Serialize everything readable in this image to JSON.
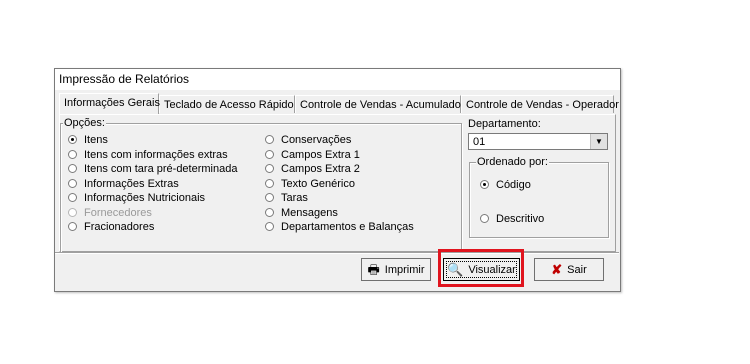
{
  "window": {
    "title": "Impressão de Relatórios"
  },
  "tabs": [
    {
      "label": "Informações Gerais",
      "active": true
    },
    {
      "label": "Teclado de Acesso Rápido",
      "active": false
    },
    {
      "label": "Controle de Vendas - Acumulados",
      "active": false
    },
    {
      "label": "Controle de Vendas - Operador",
      "active": false
    }
  ],
  "opcoes": {
    "legend": "Opções:",
    "col1": [
      {
        "label": "Itens",
        "selected": true,
        "disabled": false
      },
      {
        "label": "Itens com informações extras",
        "selected": false,
        "disabled": false
      },
      {
        "label": "Itens com tara pré-determinada",
        "selected": false,
        "disabled": false
      },
      {
        "label": "Informações Extras",
        "selected": false,
        "disabled": false
      },
      {
        "label": "Informações Nutricionais",
        "selected": false,
        "disabled": false
      },
      {
        "label": "Fornecedores",
        "selected": false,
        "disabled": true
      },
      {
        "label": "Fracionadores",
        "selected": false,
        "disabled": false
      }
    ],
    "col2": [
      {
        "label": "Conservações",
        "selected": false
      },
      {
        "label": "Campos Extra 1",
        "selected": false
      },
      {
        "label": "Campos Extra 2",
        "selected": false
      },
      {
        "label": "Texto Genérico",
        "selected": false
      },
      {
        "label": "Taras",
        "selected": false
      },
      {
        "label": "Mensagens",
        "selected": false
      },
      {
        "label": "Departamentos e Balanças",
        "selected": false
      }
    ]
  },
  "departamento": {
    "label": "Departamento:",
    "value": "01"
  },
  "ordenado": {
    "legend": "Ordenado por:",
    "options": [
      {
        "label": "Código",
        "selected": true
      },
      {
        "label": "Descritivo",
        "selected": false
      }
    ]
  },
  "buttons": {
    "imprimir": "Imprimir",
    "visualizar": "Visualizar",
    "sair": "Sair"
  },
  "colors": {
    "highlight": "#e0141e",
    "sair_icon": "#c00000"
  },
  "icons": {
    "imprimir": "printer-icon",
    "visualizar": "magnifier-icon",
    "sair": "x-icon"
  }
}
